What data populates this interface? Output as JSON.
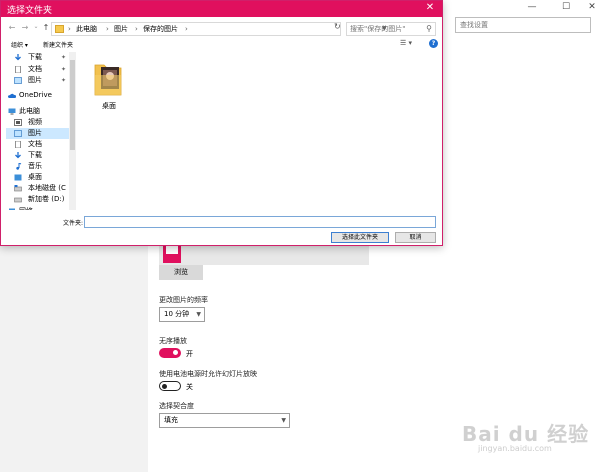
{
  "settings_window": {
    "find_setting_placeholder": "查找设置",
    "controls": [
      "—",
      "☐",
      "✕"
    ],
    "preview_label": "",
    "browse_label": "浏览",
    "frequency_label": "更改图片的频率",
    "frequency_value": "10 分钟",
    "shuffle_label": "无序播放",
    "shuffle_state": "开",
    "battery_label": "使用电池电源时允许幻灯片放映",
    "battery_state": "关",
    "fit_label": "选择契合度",
    "fit_value": "填充"
  },
  "watermark": {
    "text": "Bai du 经验",
    "sub": "jingyan.baidu.com"
  },
  "dialog": {
    "title": "选择文件夹",
    "close_glyph": "✕",
    "nav": {
      "back": "←",
      "forward": "→",
      "dropdown": "⌄",
      "up": "↑"
    },
    "breadcrumb": [
      "此电脑",
      "图片",
      "保存的图片"
    ],
    "crumb_sep": "›",
    "search_placeholder": "搜索\"保存的图片\"",
    "organize_label": "组织 ▾",
    "new_folder_label": "新建文件夹",
    "nav_items": [
      {
        "label": "下载",
        "pinned": true
      },
      {
        "label": "文档",
        "pinned": true
      },
      {
        "label": "图片",
        "pinned": true
      },
      {
        "label": "OneDrive",
        "pinned": false
      },
      {
        "label": "此电脑",
        "pinned": false
      },
      {
        "label": "视频",
        "pinned": false
      },
      {
        "label": "图片",
        "pinned": false
      },
      {
        "label": "文档",
        "pinned": false
      },
      {
        "label": "下载",
        "pinned": false
      },
      {
        "label": "音乐",
        "pinned": false
      },
      {
        "label": "桌面",
        "pinned": false
      },
      {
        "label": "本地磁盘 (C",
        "pinned": false
      },
      {
        "label": "新加卷 (D:)",
        "pinned": false
      },
      {
        "label": "网络",
        "pinned": false
      }
    ],
    "pin_glyph": "📌",
    "folder_label": "桌面",
    "filename_label": "文件夹:",
    "filename_value": "",
    "select_folder_label": "选择此文件夹",
    "cancel_label": "取消"
  }
}
